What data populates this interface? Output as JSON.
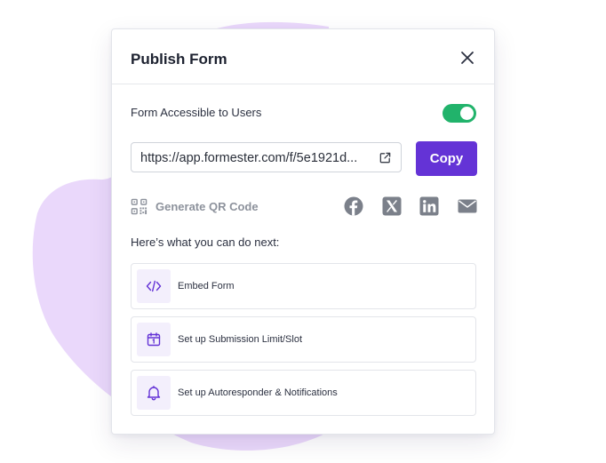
{
  "modal": {
    "title": "Publish Form",
    "access_label": "Form Accessible to Users",
    "access_enabled": true,
    "url": "https://app.formester.com/f/5e1921d...",
    "copy_label": "Copy",
    "qr_label": "Generate QR Code",
    "share_icons": [
      "facebook-icon",
      "x-icon",
      "linkedin-icon",
      "email-icon"
    ],
    "next_heading": "Here’s what you can do next:",
    "actions": [
      {
        "label": "Embed Form",
        "icon": "code-icon"
      },
      {
        "label": "Set up Submission Limit/Slot",
        "icon": "calendar-icon"
      },
      {
        "label": "Set up Autoresponder & Notifications",
        "icon": "bell-icon"
      }
    ]
  },
  "colors": {
    "accent": "#6433d6",
    "toggle_on": "#21b36b",
    "blob": "#ead8fb",
    "icon_bg": "#f3effc",
    "social_icons": "#7b808a"
  }
}
